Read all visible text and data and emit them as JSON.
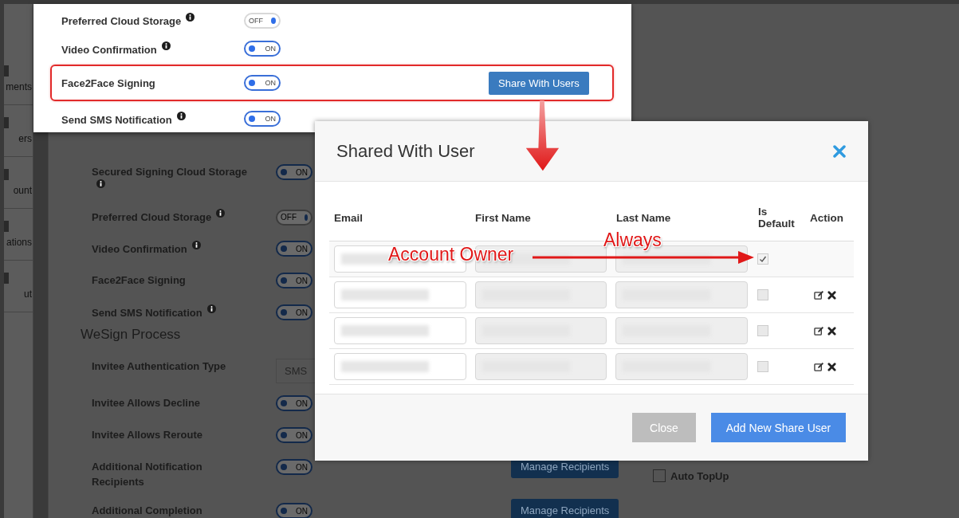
{
  "sidebar": {
    "items": [
      {
        "label": "ments"
      },
      {
        "label": "ers"
      },
      {
        "label": "ount"
      },
      {
        "label": "ations"
      },
      {
        "label": "ut"
      }
    ]
  },
  "background": {
    "rows": [
      {
        "kind": "toggle",
        "label": "Secured Signing Cloud Storage",
        "info": true,
        "on": true,
        "toggle_label": "ON"
      },
      {
        "kind": "toggle",
        "label": "Preferred Cloud Storage",
        "info": true,
        "on": false,
        "toggle_label": "OFF"
      },
      {
        "kind": "toggle",
        "label": "Video Confirmation",
        "info": true,
        "on": true,
        "toggle_label": "ON"
      },
      {
        "kind": "toggle",
        "label": "Face2Face Signing",
        "info": false,
        "on": true,
        "toggle_label": "ON"
      },
      {
        "kind": "toggle",
        "label": "Send SMS Notification",
        "info": true,
        "on": true,
        "toggle_label": "ON"
      },
      {
        "kind": "heading",
        "label": "WeSign Process"
      },
      {
        "kind": "select",
        "label": "Invitee Authentication Type",
        "value": "SMS"
      },
      {
        "kind": "toggle",
        "label": "Invitee Allows Decline",
        "info": false,
        "on": true,
        "toggle_label": "ON"
      },
      {
        "kind": "toggle",
        "label": "Invitee Allows Reroute",
        "info": false,
        "on": true,
        "toggle_label": "ON"
      },
      {
        "kind": "toggle",
        "label": "Additional Notification Recipients",
        "info": false,
        "on": true,
        "toggle_label": "ON",
        "button": "Manage Recipients",
        "checkbox": {
          "label": "Auto TopUp",
          "checked": false
        }
      },
      {
        "kind": "toggle",
        "label": "Additional Completion",
        "info": false,
        "on": true,
        "toggle_label": "ON",
        "button": "Manage Recipients"
      }
    ]
  },
  "callout": {
    "rows": [
      {
        "label": "Preferred Cloud Storage",
        "info": true,
        "on": false,
        "toggle_label": "OFF",
        "highlighted": false
      },
      {
        "label": "Video Confirmation",
        "info": true,
        "on": true,
        "toggle_label": "ON",
        "highlighted": false
      },
      {
        "label": "Face2Face Signing",
        "info": false,
        "on": true,
        "toggle_label": "ON",
        "highlighted": true,
        "button": "Share With Users"
      },
      {
        "label": "Send SMS Notification",
        "info": true,
        "on": true,
        "toggle_label": "ON",
        "highlighted": false
      }
    ]
  },
  "modal": {
    "title": "Shared With User",
    "columns": [
      "Email",
      "First Name",
      "Last Name",
      "Is Default",
      "Action"
    ],
    "rows": [
      {
        "is_default": true,
        "actions": false
      },
      {
        "is_default": false,
        "actions": true
      },
      {
        "is_default": false,
        "actions": true
      },
      {
        "is_default": false,
        "actions": true
      }
    ],
    "buttons": [
      {
        "label": "Close",
        "kind": "secondary"
      },
      {
        "label": "Add New Share User",
        "kind": "primary"
      }
    ]
  },
  "annotations": [
    {
      "text": "Account Owner"
    },
    {
      "text": "Always"
    }
  ]
}
